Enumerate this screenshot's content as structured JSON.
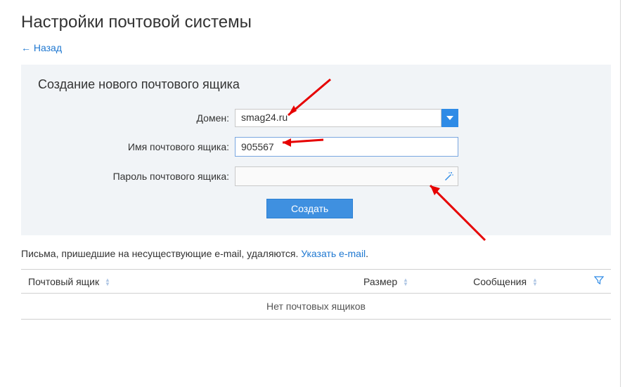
{
  "page": {
    "title": "Настройки почтовой системы",
    "back_label": "← Назад"
  },
  "panel": {
    "title": "Создание нового почтового ящика",
    "domain_label": "Домен:",
    "domain_value": "smag24.ru",
    "mailbox_label": "Имя почтового ящика:",
    "mailbox_value": "905567",
    "password_label": "Пароль почтового ящика:",
    "password_value": "",
    "submit_label": "Создать"
  },
  "note": {
    "text": "Письма, пришедшие на несуществующие e-mail, удаляются. ",
    "link": "Указать e-mail",
    "suffix": "."
  },
  "table": {
    "columns": {
      "mailbox": "Почтовый ящик",
      "size": "Размер",
      "messages": "Сообщения"
    },
    "empty_text": "Нет почтовых ящиков"
  }
}
